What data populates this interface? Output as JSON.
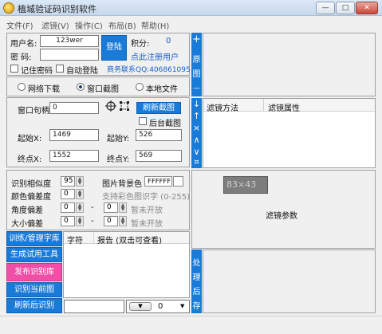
{
  "window": {
    "title": "植城验证码识别软件",
    "min": "—",
    "max": "□",
    "close": "✕"
  },
  "menu": [
    "文件(F)",
    "滤镜(V)",
    "操作(C)",
    "布局(B)",
    "帮助(H)"
  ],
  "login": {
    "username_label": "用户名:",
    "username_value": "123wer",
    "password_label": "密  码:",
    "password_value": "",
    "remember_label": "记住密码",
    "autologin_label": "自动登陆",
    "login_button": "登陆",
    "points_label": "积分:",
    "points_value": "0",
    "register_link": "点此注册用户",
    "contact": "商务联系QQ:406861095"
  },
  "mode": {
    "options": [
      "网络下载",
      "窗口截图",
      "本地文件"
    ],
    "selected": 1
  },
  "capture": {
    "handle_label": "窗口句柄:",
    "handle_value": "0",
    "crosshair_icon": "crosshair-icon",
    "frame_icon": "frame-select-icon",
    "refresh_button": "刷新截图",
    "background_label": "后台截图",
    "start_x_label": "起始X:",
    "start_x": "1469",
    "start_y_label": "起始Y:",
    "start_y": "526",
    "end_x_label": "终点X:",
    "end_x": "1552",
    "end_y_label": "终点Y:",
    "end_y": "569"
  },
  "vstrip_top": [
    "+",
    "原",
    "图",
    "—"
  ],
  "filter_strip": [
    "↓",
    "↑",
    "×",
    "∧",
    "∨",
    "¤"
  ],
  "filter_table": {
    "col1": "滤镜方法",
    "col2": "滤镜属性"
  },
  "params": {
    "preview": "83×43",
    "label": "滤镜参数"
  },
  "recog": {
    "similarity_label": "识别相似度",
    "similarity_value": "95",
    "color_diff_label": "颜色偏差度",
    "color_diff_value": "0",
    "angle_label": "角度偏差",
    "angle_a": "0",
    "angle_b": "0",
    "size_label": "大小偏差",
    "size_a": "0",
    "size_b": "0",
    "dash": "-",
    "not_open": "暂未开放",
    "bg_label": "图片背景色",
    "bg_value": "FFFFFF",
    "multicolor_label": "支持彩色图识字 (0-255)"
  },
  "actions": [
    "训练/管理字库",
    "生成试用工具",
    "发布识别库",
    "识别当前图",
    "刷新后识别"
  ],
  "result_table": {
    "col1": "字符",
    "col2": "报告 (双击可查看)"
  },
  "bottom_select": "0",
  "process_strip": [
    "处",
    "理",
    "后",
    "存"
  ],
  "colors": {
    "accent": "#1a7ad8",
    "pink": "#ef4fa6"
  }
}
